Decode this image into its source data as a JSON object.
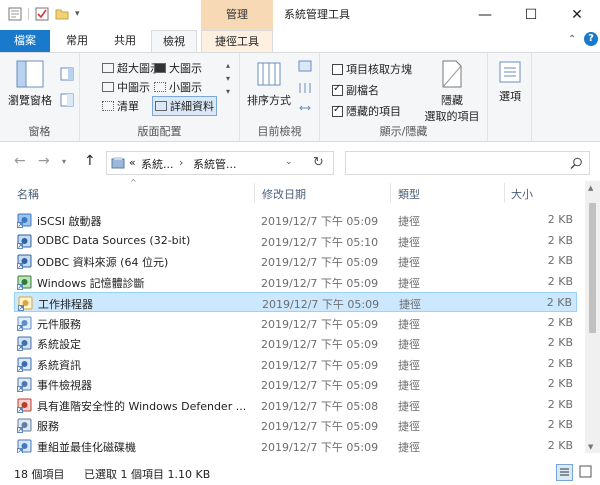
{
  "window": {
    "title": "系統管理工具",
    "context_tab": "管理"
  },
  "tabs": [
    "檔案",
    "常用",
    "共用",
    "檢視",
    "捷徑工具"
  ],
  "ribbon": {
    "pane_label": "瀏覽窗格",
    "pane_group": "窗格",
    "layout_items": [
      "超大圖示",
      "大圖示",
      "中圖示",
      "小圖示",
      "清單",
      "詳細資料"
    ],
    "layout_group": "版面配置",
    "sort_label": "排序方式",
    "current_view_group": "目前檢視",
    "show_hide": {
      "item_checkbox": {
        "label": "項目核取方塊",
        "checked": false
      },
      "file_ext": {
        "label": "副檔名",
        "checked": true
      },
      "hidden_items": {
        "label": "隱藏的項目",
        "checked": true
      }
    },
    "hide_selected_line1": "隱藏",
    "hide_selected_line2": "選取的項目",
    "show_hide_group": "顯示/隱藏",
    "options_label": "選項"
  },
  "address": {
    "crumb_prefix": "«",
    "crumb1": "系統...",
    "crumb2": "系統管...",
    "search_placeholder": ""
  },
  "columns": {
    "name": "名稱",
    "date": "修改日期",
    "type": "類型",
    "size": "大小"
  },
  "files": [
    {
      "name": "iSCSI 啟動器",
      "date": "2019/12/7 下午 05:09",
      "type": "捷徑",
      "size": "2 KB",
      "icon": "iscsi-icon"
    },
    {
      "name": "ODBC Data Sources (32-bit)",
      "date": "2019/12/7 下午 05:10",
      "type": "捷徑",
      "size": "2 KB",
      "icon": "odbc-icon"
    },
    {
      "name": "ODBC 資料來源 (64 位元)",
      "date": "2019/12/7 下午 05:09",
      "type": "捷徑",
      "size": "2 KB",
      "icon": "odbc-icon"
    },
    {
      "name": "Windows 記憶體診斷",
      "date": "2019/12/7 下午 05:09",
      "type": "捷徑",
      "size": "2 KB",
      "icon": "memory-icon"
    },
    {
      "name": "工作排程器",
      "date": "2019/12/7 下午 05:09",
      "type": "捷徑",
      "size": "2 KB",
      "icon": "scheduler-icon",
      "selected": true
    },
    {
      "name": "元件服務",
      "date": "2019/12/7 下午 05:09",
      "type": "捷徑",
      "size": "2 KB",
      "icon": "component-icon"
    },
    {
      "name": "系統設定",
      "date": "2019/12/7 下午 05:09",
      "type": "捷徑",
      "size": "2 KB",
      "icon": "config-icon"
    },
    {
      "name": "系統資訊",
      "date": "2019/12/7 下午 05:09",
      "type": "捷徑",
      "size": "2 KB",
      "icon": "info-icon"
    },
    {
      "name": "事件檢視器",
      "date": "2019/12/7 下午 05:09",
      "type": "捷徑",
      "size": "2 KB",
      "icon": "event-icon"
    },
    {
      "name": "具有進階安全性的 Windows Defender ...",
      "date": "2019/12/7 下午 05:08",
      "type": "捷徑",
      "size": "2 KB",
      "icon": "firewall-icon"
    },
    {
      "name": "服務",
      "date": "2019/12/7 下午 05:09",
      "type": "捷徑",
      "size": "2 KB",
      "icon": "services-icon"
    },
    {
      "name": "重組並最佳化磁碟機",
      "date": "2019/12/7 下午 05:09",
      "type": "捷徑",
      "size": "2 KB",
      "icon": "defrag-icon"
    }
  ],
  "status": {
    "count": "18 個項目",
    "selected": "已選取 1 個項目  1.10 KB"
  }
}
